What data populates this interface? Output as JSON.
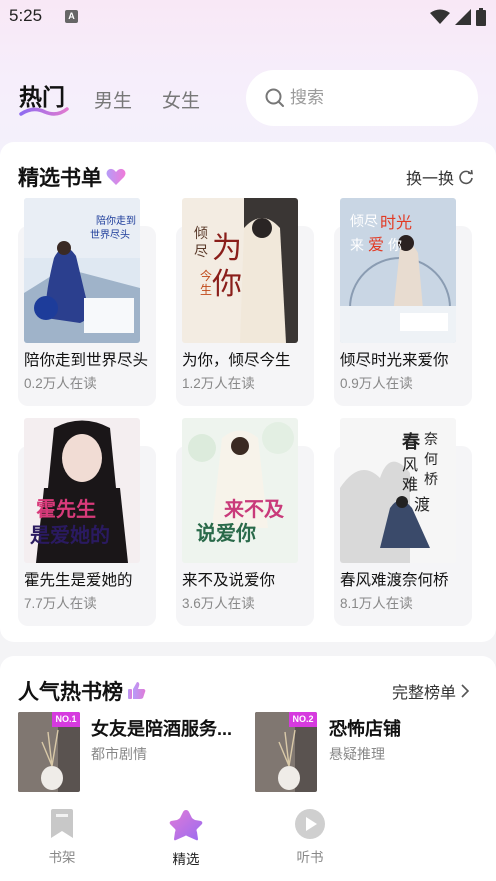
{
  "status_bar": {
    "time": "5:25",
    "notification_icon": "A"
  },
  "header": {
    "tabs": [
      {
        "label": "热门",
        "active": true
      },
      {
        "label": "男生",
        "active": false
      },
      {
        "label": "女生",
        "active": false
      }
    ],
    "search": {
      "placeholder": "搜索"
    }
  },
  "featured": {
    "title": "精选书单",
    "title_icon": "heart-icon",
    "action_label": "换一换",
    "action_icon": "refresh-icon",
    "books": [
      {
        "title": "陪你走到世界尽头",
        "readers": "0.2万人在读",
        "cover_text": "陪你走到世界尽头"
      },
      {
        "title": "为你，倾尽今生",
        "readers": "1.2万人在读",
        "cover_text": "倾尽今生为你"
      },
      {
        "title": "倾尽时光来爱你",
        "readers": "0.9万人在读",
        "cover_text": "倾尽时光来爱你"
      },
      {
        "title": "霍先生是爱她的",
        "readers": "7.7万人在读",
        "cover_text": "霍先生是爱她的"
      },
      {
        "title": "来不及说爱你",
        "readers": "3.6万人在读",
        "cover_text": "来不及说爱你"
      },
      {
        "title": "春风难渡奈何桥",
        "readers": "8.1万人在读",
        "cover_text": "春奈风何难桥渡"
      }
    ]
  },
  "ranking": {
    "title": "人气热书榜",
    "title_icon": "thumbs-up-icon",
    "action_label": "完整榜单",
    "items": [
      {
        "rank": "NO.1",
        "title": "女友是陪酒服务...",
        "genre": "都市剧情"
      },
      {
        "rank": "NO.2",
        "title": "恐怖店铺",
        "genre": "悬疑推理"
      }
    ]
  },
  "bottom_nav": [
    {
      "label": "书架",
      "icon": "bookmark-icon",
      "active": false
    },
    {
      "label": "精选",
      "icon": "star-icon",
      "active": true
    },
    {
      "label": "听书",
      "icon": "play-icon",
      "active": false
    }
  ],
  "colors": {
    "accent_purple": "#b455e6",
    "heart_pink": "#f07ad8",
    "rank_badge": "#d63adf",
    "text_primary": "#111111",
    "text_secondary": "#888888"
  }
}
